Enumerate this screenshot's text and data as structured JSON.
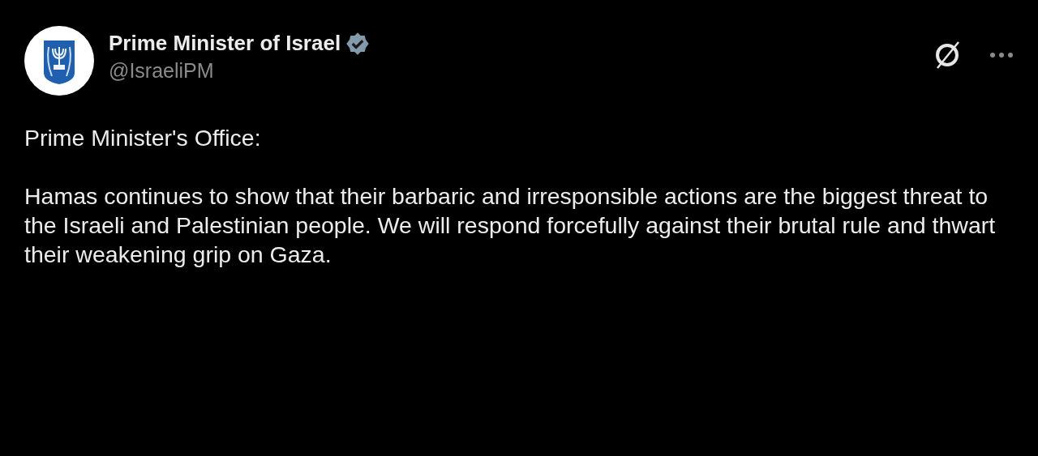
{
  "post": {
    "author": {
      "name": "Prime Minister of Israel",
      "verified": true,
      "handle": "@IsraeliPM"
    },
    "paragraphs": [
      "Prime Minister's Office:",
      "Hamas continues to show that their barbaric and irresponsible actions are the biggest threat to the Israeli and Palestinian people. We will respond forcefully against their brutal rule and thwart their weakening grip on Gaza."
    ]
  }
}
